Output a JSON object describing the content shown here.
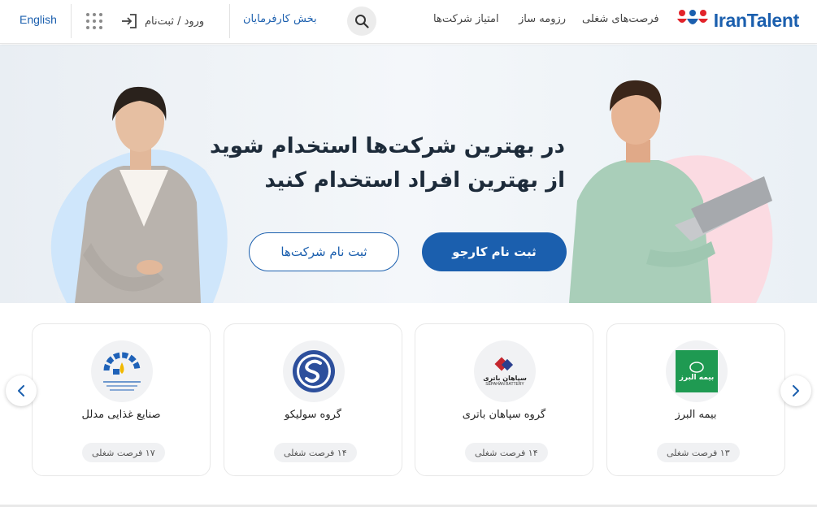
{
  "header": {
    "logo_text": "IranTalent",
    "nav": {
      "jobs": "فرصت‌های شغلی",
      "resume": "رزومه ساز",
      "company_rating": "امتیاز شرکت‌ها"
    },
    "employer": "بخش کارفرمایان",
    "login": "ورود / ثبت‌نام",
    "language": "English",
    "icons": {
      "search": "search-icon",
      "apps": "grid-icon",
      "login": "login-icon"
    }
  },
  "hero": {
    "title_line1": "در بهترین شرکت‌ها استخدام شوید",
    "title_line2": "از بهترین افراد استخدام کنید",
    "jobseeker_button": "ثبت نام کارجو",
    "company_button": "ثبت نام شرکت‌ها"
  },
  "companies": [
    {
      "name": "بیمه البرز",
      "jobs": "۱۳ فرصت شغلی",
      "logo_text": "بیمه البرز"
    },
    {
      "name": "گروه سپاهان باتری",
      "jobs": "۱۴ فرصت شغلی",
      "logo_text": "سپاهان باتری",
      "logo_subtext": "SEPAHAN BATTERY"
    },
    {
      "name": "گروه سولیکو",
      "jobs": "۱۴ فرصت شغلی"
    },
    {
      "name": "صنایع غذایی مدلل",
      "jobs": "۱۷ فرصت شغلی"
    }
  ],
  "colors": {
    "brand_blue": "#1b5fae",
    "brand_red": "#e2232a",
    "alborz_green": "#1f9a52"
  }
}
